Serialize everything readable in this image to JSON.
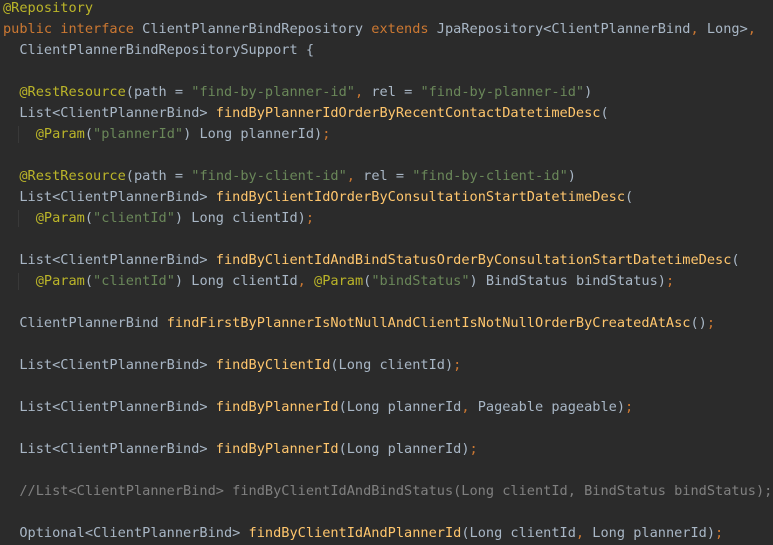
{
  "editor": {
    "language": "java",
    "colors": {
      "background": "#2b2b2b",
      "keyword": "#cc7832",
      "annotation": "#bbb529",
      "string": "#6a8759",
      "method": "#ffc66d",
      "text": "#a9b7c6",
      "comment": "#808080"
    },
    "lines": [
      [
        {
          "t": "@Repository",
          "c": "ann"
        }
      ],
      [
        {
          "t": "public interface ",
          "c": "kw"
        },
        {
          "t": "ClientPlannerBindRepository ",
          "c": "pl"
        },
        {
          "t": "extends ",
          "c": "kw"
        },
        {
          "t": "JpaRepository<ClientPlannerBind",
          "c": "pl"
        },
        {
          "t": ", ",
          "c": "kw"
        },
        {
          "t": "Long>",
          "c": "pl"
        },
        {
          "t": ",",
          "c": "kw"
        }
      ],
      [
        {
          "t": "  ClientPlannerBindRepositorySupport {",
          "c": "pl"
        }
      ],
      [],
      [
        {
          "t": "  ",
          "c": "pl"
        },
        {
          "t": "@RestResource",
          "c": "ann"
        },
        {
          "t": "(path = ",
          "c": "pl"
        },
        {
          "t": "\"find-by-planner-id\"",
          "c": "str"
        },
        {
          "t": ", ",
          "c": "kw"
        },
        {
          "t": "rel = ",
          "c": "pl"
        },
        {
          "t": "\"find-by-planner-id\"",
          "c": "str"
        },
        {
          "t": ")",
          "c": "pl"
        }
      ],
      [
        {
          "t": "  List<ClientPlannerBind> ",
          "c": "pl"
        },
        {
          "t": "findByPlannerIdOrderByRecentContactDatetimeDesc",
          "c": "fn"
        },
        {
          "t": "(",
          "c": "pl"
        }
      ],
      [
        {
          "t": "    ",
          "c": "pl"
        },
        {
          "t": "@Param",
          "c": "ann"
        },
        {
          "t": "(",
          "c": "pl"
        },
        {
          "t": "\"plannerId\"",
          "c": "str"
        },
        {
          "t": ") Long plannerId)",
          "c": "pl"
        },
        {
          "t": ";",
          "c": "kw"
        }
      ],
      [],
      [
        {
          "t": "  ",
          "c": "pl"
        },
        {
          "t": "@RestResource",
          "c": "ann"
        },
        {
          "t": "(path = ",
          "c": "pl"
        },
        {
          "t": "\"find-by-client-id\"",
          "c": "str"
        },
        {
          "t": ", ",
          "c": "kw"
        },
        {
          "t": "rel = ",
          "c": "pl"
        },
        {
          "t": "\"find-by-client-id\"",
          "c": "str"
        },
        {
          "t": ")",
          "c": "pl"
        }
      ],
      [
        {
          "t": "  List<ClientPlannerBind> ",
          "c": "pl"
        },
        {
          "t": "findByClientIdOrderByConsultationStartDatetimeDesc",
          "c": "fn"
        },
        {
          "t": "(",
          "c": "pl"
        }
      ],
      [
        {
          "t": "    ",
          "c": "pl"
        },
        {
          "t": "@Param",
          "c": "ann"
        },
        {
          "t": "(",
          "c": "pl"
        },
        {
          "t": "\"clientId\"",
          "c": "str"
        },
        {
          "t": ") Long clientId)",
          "c": "pl"
        },
        {
          "t": ";",
          "c": "kw"
        }
      ],
      [],
      [
        {
          "t": "  List<ClientPlannerBind> ",
          "c": "pl"
        },
        {
          "t": "findByClientIdAndBindStatusOrderByConsultationStartDatetimeDesc",
          "c": "fn"
        },
        {
          "t": "(",
          "c": "pl"
        }
      ],
      [
        {
          "t": "    ",
          "c": "pl"
        },
        {
          "t": "@Param",
          "c": "ann"
        },
        {
          "t": "(",
          "c": "pl"
        },
        {
          "t": "\"clientId\"",
          "c": "str"
        },
        {
          "t": ") Long clientId",
          "c": "pl"
        },
        {
          "t": ", ",
          "c": "kw"
        },
        {
          "t": "@Param",
          "c": "ann"
        },
        {
          "t": "(",
          "c": "pl"
        },
        {
          "t": "\"bindStatus\"",
          "c": "str"
        },
        {
          "t": ") BindStatus bindStatus)",
          "c": "pl"
        },
        {
          "t": ";",
          "c": "kw"
        }
      ],
      [],
      [
        {
          "t": "  ClientPlannerBind ",
          "c": "pl"
        },
        {
          "t": "findFirstByPlannerIsNotNullAndClientIsNotNullOrderByCreatedAtAsc",
          "c": "fn"
        },
        {
          "t": "()",
          "c": "pl"
        },
        {
          "t": ";",
          "c": "kw"
        }
      ],
      [],
      [
        {
          "t": "  List<ClientPlannerBind> ",
          "c": "pl"
        },
        {
          "t": "findByClientId",
          "c": "fn"
        },
        {
          "t": "(Long clientId)",
          "c": "pl"
        },
        {
          "t": ";",
          "c": "kw"
        }
      ],
      [],
      [
        {
          "t": "  List<ClientPlannerBind> ",
          "c": "pl"
        },
        {
          "t": "findByPlannerId",
          "c": "fn"
        },
        {
          "t": "(Long plannerId",
          "c": "pl"
        },
        {
          "t": ", ",
          "c": "kw"
        },
        {
          "t": "Pageable pageable)",
          "c": "pl"
        },
        {
          "t": ";",
          "c": "kw"
        }
      ],
      [],
      [
        {
          "t": "  List<ClientPlannerBind> ",
          "c": "pl"
        },
        {
          "t": "findByPlannerId",
          "c": "fn"
        },
        {
          "t": "(Long plannerId)",
          "c": "pl"
        },
        {
          "t": ";",
          "c": "kw"
        }
      ],
      [],
      [
        {
          "t": "  //List<ClientPlannerBind> findByClientIdAndBindStatus(Long clientId, BindStatus bindStatus);",
          "c": "com"
        }
      ],
      [],
      [
        {
          "t": "  Optional<ClientPlannerBind> ",
          "c": "pl"
        },
        {
          "t": "findByClientIdAndPlannerId",
          "c": "fn"
        },
        {
          "t": "(Long clientId",
          "c": "pl"
        },
        {
          "t": ", ",
          "c": "kw"
        },
        {
          "t": "Long plannerId)",
          "c": "pl"
        },
        {
          "t": ";",
          "c": "kw"
        }
      ]
    ]
  }
}
